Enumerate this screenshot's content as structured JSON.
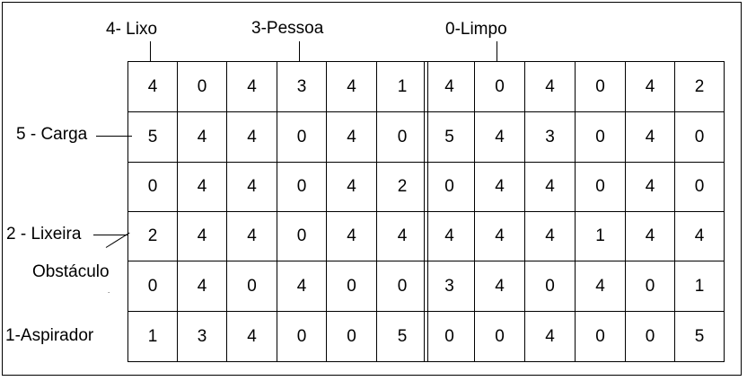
{
  "labels": {
    "lixo": "4- Lixo",
    "pessoa": "3-Pessoa",
    "limpo": "0-Limpo",
    "carga": "5 - Carga",
    "lixeira": "2 - Lixeira",
    "obstaculo": "Obstáculo",
    "aspirador": "1-Aspirador"
  },
  "grid_left": [
    [
      "4",
      "0",
      "4",
      "3",
      "4",
      "1"
    ],
    [
      "5",
      "4",
      "4",
      "0",
      "4",
      "0"
    ],
    [
      "0",
      "4",
      "4",
      "0",
      "4",
      "2"
    ],
    [
      "2",
      "4",
      "4",
      "0",
      "4",
      "4"
    ],
    [
      "0",
      "4",
      "0",
      "4",
      "0",
      "0"
    ],
    [
      "1",
      "3",
      "4",
      "0",
      "0",
      "5"
    ]
  ],
  "grid_right": [
    [
      "4",
      "0",
      "4",
      "0",
      "4",
      "2"
    ],
    [
      "5",
      "4",
      "3",
      "0",
      "4",
      "0"
    ],
    [
      "0",
      "4",
      "4",
      "0",
      "4",
      "0"
    ],
    [
      "4",
      "4",
      "4",
      "1",
      "4",
      "4"
    ],
    [
      "3",
      "4",
      "0",
      "4",
      "0",
      "1"
    ],
    [
      "0",
      "0",
      "4",
      "0",
      "0",
      "5"
    ]
  ]
}
